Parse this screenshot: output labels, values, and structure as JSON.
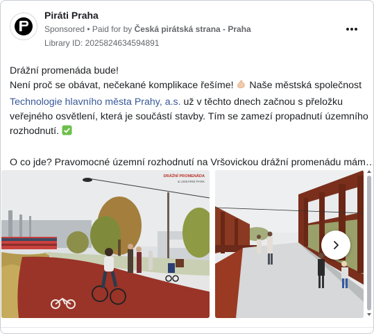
{
  "post": {
    "page_name": "Piráti Praha",
    "sponsored_label": "Sponsored",
    "separator": " • ",
    "paid_for_prefix": "Paid for by ",
    "paid_for_by": "Česká pirátská strana - Praha",
    "library_id": "Library ID: 2025824634594891",
    "more_icon": "more-horizontal-icon"
  },
  "text": {
    "line1": "Drážní promenáda bude!",
    "line2a": "Není proč se obávat, nečekané komplikace řešíme! ",
    "line2_emoji": "muscle-emoji",
    "line2b": " Naše městská společnost",
    "line3_link": "Technologie hlavního města Prahy, a.s.",
    "line3_rest": " už v těchto dnech začnou s přeložku",
    "line4": "veřejného osvětlení, která je součástí stavby. Tím se zamezí propadnutí územního",
    "line5": "rozhodnutí. ",
    "line5_emoji": "check-mark-emoji",
    "line6": "O co jde? Pravomocné územní rozhodnutí na Vršovickou drážní promenádu mám…"
  },
  "carousel": {
    "slide1_watermark_title": "DRÁŽNÍ PROMENÁDA",
    "slide1_watermark_sub": "& LINEÁRNÍ PARK",
    "next_icon": "chevron-right-icon"
  },
  "colors": {
    "link": "#385898",
    "muted": "#65676b",
    "check_green": "#6cc04a"
  }
}
